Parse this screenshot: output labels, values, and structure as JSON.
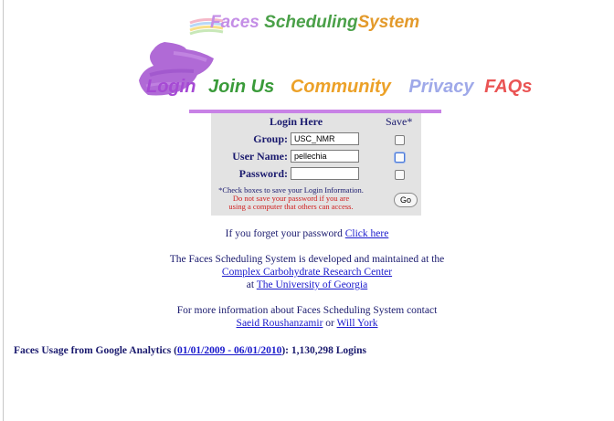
{
  "logo": {
    "word1": "Faces",
    "word2": "Scheduling",
    "word3": "System"
  },
  "nav": [
    "Login",
    "Join Us",
    "Community",
    "Privacy",
    "FAQs"
  ],
  "login": {
    "heading": "Login Here",
    "save_label": "Save*",
    "group_label": "Group:",
    "group_value": "USC_NMR",
    "username_label": "User Name:",
    "username_value": "pellechia",
    "password_label": "Password:",
    "password_value": "",
    "note_line1": "*Check boxes to save your Login Information.",
    "note_line2": "Do not save your password if you are",
    "note_line3": "using a computer that others can access.",
    "go_label": "Go"
  },
  "forgot": {
    "text": "If you forget your password ",
    "link": "Click here"
  },
  "about": {
    "line1": "The Faces Scheduling System is developed and maintained at the",
    "link1": "Complex Carbohydrate Research Center",
    "at": "at ",
    "link2": "The University of Georgia"
  },
  "contact": {
    "line1": "For more information about Faces Scheduling System contact",
    "person1": "Saeid Roushanzamir",
    "or": " or ",
    "person2": "Will York"
  },
  "analytics": {
    "prefix": "Faces Usage from Google Analytics (",
    "date_range": "01/01/2009 - 06/01/2010",
    "suffix": "): 1,130,298 Logins"
  },
  "colors": {
    "nav_login": "#a64ad4",
    "nav_join": "#3a9b3a",
    "nav_community": "#eca128",
    "nav_privacy": "#9fa9e9",
    "nav_faqs": "#ea5454",
    "accent_bar": "#c882e6"
  }
}
